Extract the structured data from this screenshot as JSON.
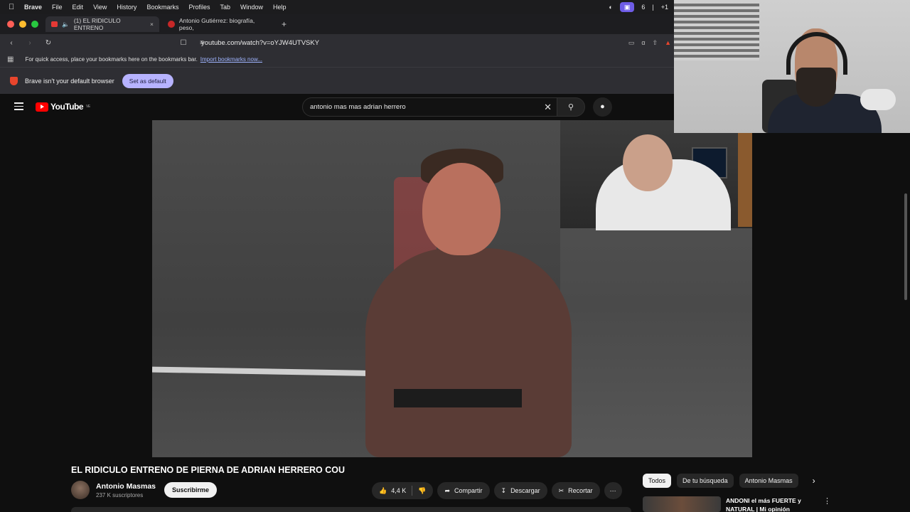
{
  "menubar": {
    "app": "Brave",
    "items": [
      "File",
      "Edit",
      "View",
      "History",
      "Bookmarks",
      "Profiles",
      "Tab",
      "Window",
      "Help"
    ],
    "count": "6",
    "badge": "+1"
  },
  "tabs": [
    {
      "label": "(1) EL RIDICULO ENTRENO",
      "active": true
    },
    {
      "label": "Antonio Gutiérrez: biografía, peso,",
      "active": false
    }
  ],
  "address": {
    "url": "youtube.com/watch?v=oYJW4UTVSKY"
  },
  "bookmarks": {
    "text": "For quick access, place your bookmarks here on the bookmarks bar.",
    "link": "Import bookmarks now..."
  },
  "default_bar": {
    "text": "Brave isn't your default browser",
    "button": "Set as default"
  },
  "youtube": {
    "logo": "YouTube",
    "region": "VE",
    "search": "antonio mas mas adrian herrero"
  },
  "video": {
    "title": "EL RIDICULO ENTRENO DE PIERNA DE ADRIAN HERRERO COU",
    "channel": "Antonio Masmas",
    "subscribers": "237 K suscriptores",
    "subscribe": "Suscribirme",
    "likes": "4,4 K",
    "share": "Compartir",
    "download": "Descargar",
    "clip": "Recortar"
  },
  "chips": [
    "Todos",
    "De tu búsqueda",
    "Antonio Masmas"
  ],
  "recommendation": {
    "title": "ANDONI el más FUERTE y NATURAL | Mi opinión"
  },
  "colors": {
    "accent": "#ff0000",
    "brave": "#e8452c",
    "setdefault": "#b7b3ff"
  }
}
